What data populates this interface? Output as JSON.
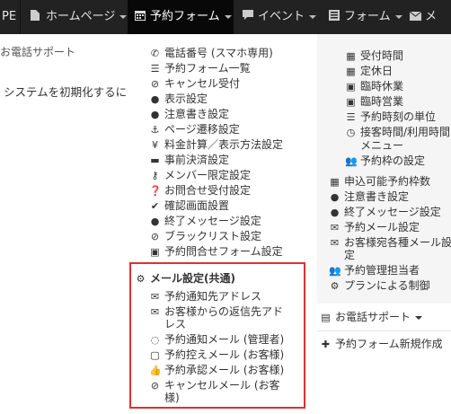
{
  "nav": {
    "pe": "PE",
    "homepage": "ホームページ",
    "form_reserve": "予約フォーム",
    "event": "イベント",
    "form": "フォーム",
    "mail": "メ"
  },
  "left": {
    "phone_support": "お電話サポート",
    "reset_text": "システムを初期化するに"
  },
  "center": {
    "items": [
      "電話番号 (スマホ専用)",
      "予約フォーム一覧",
      "キャンセル受付",
      "表示設定",
      "注意書き設定",
      "ページ遷移設定",
      "料金計算／表示方法設定",
      "事前決済設定",
      "メンバー限定設定",
      "お問合せ受付設定",
      "確認画面設置",
      "終了メッセージ設定",
      "ブラックリスト設定",
      "予約問合せフォーム設定"
    ],
    "mail_header": "メール設定(共通)",
    "mail_items": [
      "予約通知先アドレス",
      "お客様からの返信先アド",
      "レス",
      "予約通知メール (管理者)",
      "予約控えメール (お客様)",
      "予約承認メール (お客様)",
      "キャンセルメール (お客",
      "様)"
    ]
  },
  "right": {
    "sub_items": [
      "受付時間",
      "定休日",
      "臨時休業",
      "臨時営業",
      "予約時刻の単位",
      "接客時間/利用時間",
      "メニュー",
      "予約枠の設定"
    ],
    "items": [
      "申込可能予約枠数",
      "注意書き設定",
      "終了メッセージ設定",
      "予約メール設定",
      "お客様宛各種メール設",
      "定",
      "予約管理担当者",
      "プランによる制御"
    ],
    "phone_support": "お電話サポート",
    "new_form": "予約フォーム新規作成"
  }
}
